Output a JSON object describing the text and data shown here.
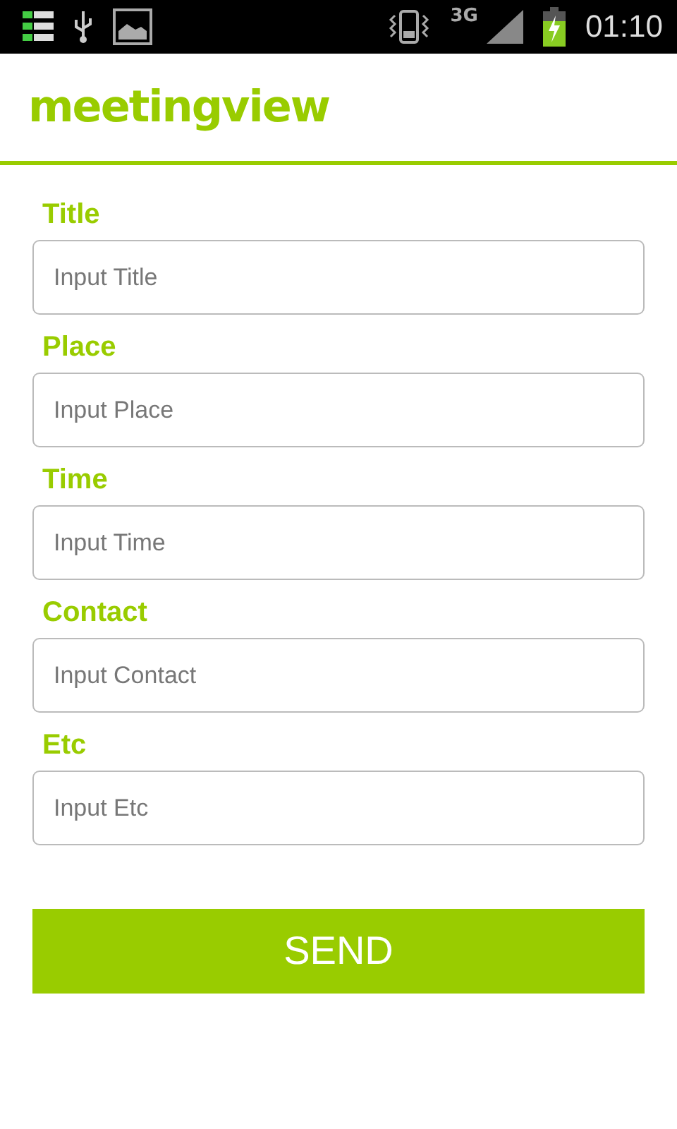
{
  "status_bar": {
    "network": "3G",
    "time": "01:10"
  },
  "header": {
    "logo": "meetingview"
  },
  "fields": [
    {
      "label": "Title",
      "placeholder": "Input Title"
    },
    {
      "label": "Place",
      "placeholder": "Input Place"
    },
    {
      "label": "Time",
      "placeholder": "Input Time"
    },
    {
      "label": "Contact",
      "placeholder": "Input Contact"
    },
    {
      "label": "Etc",
      "placeholder": "Input Etc"
    }
  ],
  "send_button": "SEND"
}
